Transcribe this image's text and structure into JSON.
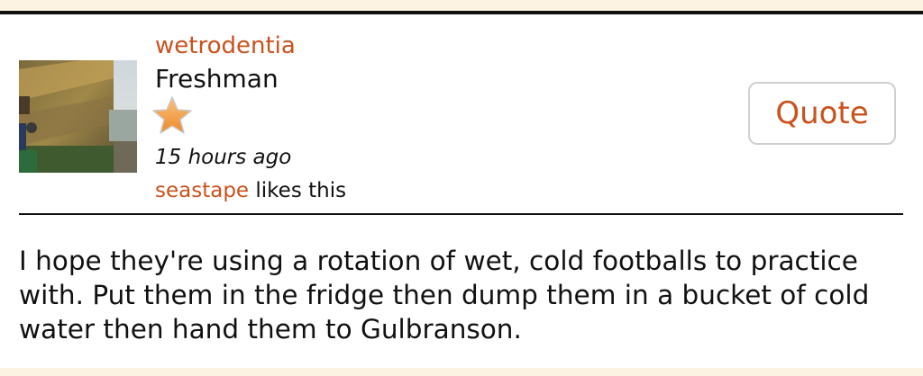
{
  "post": {
    "author": {
      "username": "wetrodentia",
      "rank": "Freshman",
      "rank_icon": "star-icon"
    },
    "timestamp": "15 hours ago",
    "likes": {
      "liker": "seastape",
      "suffix": " likes this"
    },
    "quote_label": "Quote",
    "body": "I hope they're using a rotation of wet, cold footballs to practice with. Put them in the fridge then dump them in a bucket of cold water then hand them to Gulbranson."
  },
  "colors": {
    "link": "#c9521d",
    "background": "#fdf3e2",
    "text": "#111111",
    "star": "#f4a24a"
  }
}
